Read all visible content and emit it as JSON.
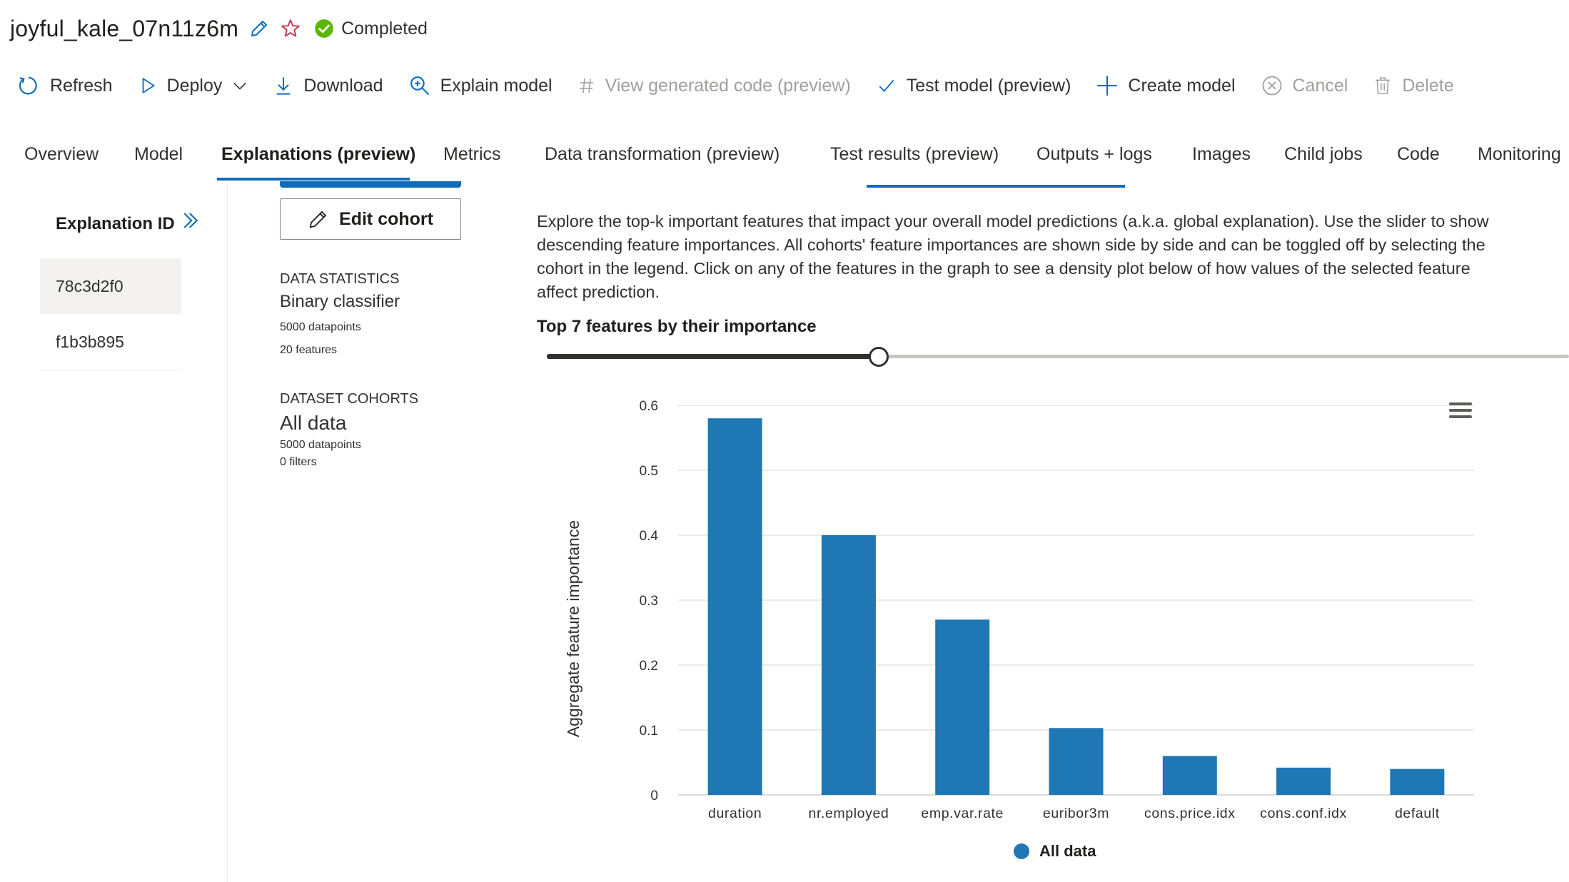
{
  "header": {
    "title": "joyful_kale_07n11z6m",
    "status": "Completed",
    "colors": {
      "edit": "#0f6cbd",
      "star": "#c4314b",
      "status": "#5bb700"
    }
  },
  "toolbar": {
    "refresh": "Refresh",
    "deploy": "Deploy",
    "download": "Download",
    "explain_model": "Explain model",
    "view_code": "View generated code (preview)",
    "test_model": "Test model (preview)",
    "create_model": "Create model",
    "cancel": "Cancel",
    "delete": "Delete"
  },
  "tabs": [
    {
      "label": "Overview"
    },
    {
      "label": "Model"
    },
    {
      "label": "Explanations (preview)"
    },
    {
      "label": "Metrics"
    },
    {
      "label": "Data transformation (preview)"
    },
    {
      "label": "Test results (preview)"
    },
    {
      "label": "Outputs + logs"
    },
    {
      "label": "Images"
    },
    {
      "label": "Child jobs"
    },
    {
      "label": "Code"
    },
    {
      "label": "Monitoring"
    }
  ],
  "explanations": {
    "header": "Explanation ID",
    "items": [
      "78c3d2f0",
      "f1b3b895"
    ]
  },
  "cohort": {
    "edit_button": "Edit cohort",
    "data_stats_label": "DATA STATISTICS",
    "classifier": "Binary classifier",
    "datapoints": "5000 datapoints",
    "features": "20 features",
    "dataset_cohorts_label": "DATASET COHORTS",
    "cohort_name": "All data",
    "cohort_datapoints": "5000 datapoints",
    "cohort_filters": "0 filters"
  },
  "description": "Explore the top-k important features that impact your overall model predictions (a.k.a. global explanation). Use the slider to show descending feature importances. All cohorts' feature importances are shown side by side and can be toggled off by selecting the cohort in the legend. Click on any of the features in the graph to see a density plot below of how values of the selected feature affect prediction.",
  "top_k_label": "Top 7 features by their importance",
  "slider": {
    "value": 7,
    "min": 1,
    "max": 20
  },
  "chart_data": {
    "type": "bar",
    "categories": [
      "duration",
      "nr.employed",
      "emp.var.rate",
      "euribor3m",
      "cons.price.idx",
      "cons.conf.idx",
      "default"
    ],
    "series": [
      {
        "name": "All data",
        "values": [
          0.58,
          0.4,
          0.27,
          0.103,
          0.06,
          0.042,
          0.04
        ],
        "color": "#1f77b4"
      }
    ],
    "xlabel": "",
    "ylabel": "Aggregate feature importance",
    "ylim": [
      0,
      0.6
    ],
    "yticks": [
      "0",
      "0.1",
      "0.2",
      "0.3",
      "0.4",
      "0.5",
      "0.6"
    ],
    "grid": true,
    "legend": "bottom"
  }
}
